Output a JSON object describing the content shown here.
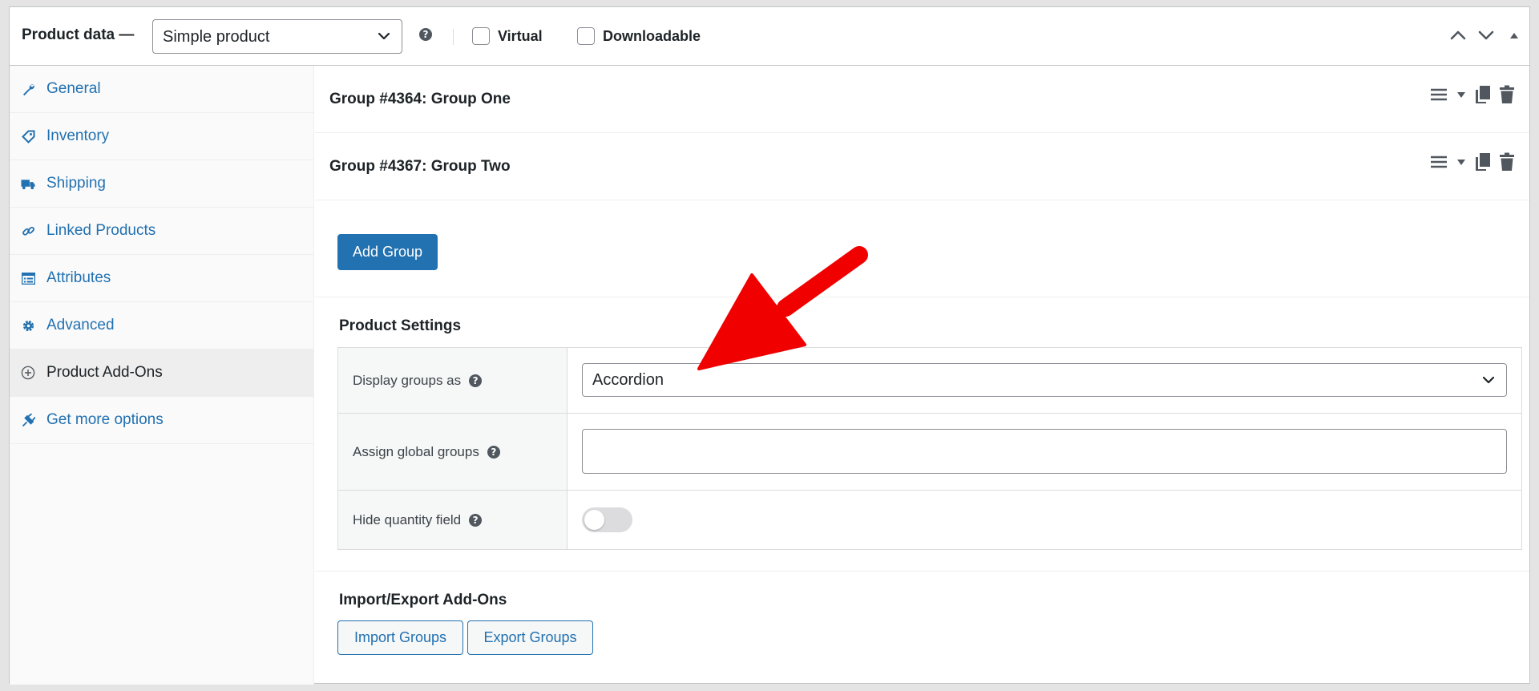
{
  "header": {
    "title": "Product data —",
    "product_type": "Simple product",
    "virtual_label": "Virtual",
    "downloadable_label": "Downloadable"
  },
  "sidebar": {
    "items": [
      {
        "label": "General",
        "icon": "wrench-icon"
      },
      {
        "label": "Inventory",
        "icon": "tag-icon"
      },
      {
        "label": "Shipping",
        "icon": "truck-icon"
      },
      {
        "label": "Linked Products",
        "icon": "link-icon"
      },
      {
        "label": "Attributes",
        "icon": "list-icon"
      },
      {
        "label": "Advanced",
        "icon": "gear-icon"
      },
      {
        "label": "Product Add-Ons",
        "icon": "plus-circle-icon"
      },
      {
        "label": "Get more options",
        "icon": "plugin-icon"
      }
    ],
    "active_index": 6
  },
  "groups": [
    {
      "title": "Group #4364: Group One"
    },
    {
      "title": "Group #4367: Group Two"
    }
  ],
  "add_group_label": "Add Group",
  "product_settings": {
    "title": "Product Settings",
    "display_groups_label": "Display groups as",
    "display_groups_value": "Accordion",
    "assign_global_label": "Assign global groups",
    "assign_global_value": "",
    "hide_quantity_label": "Hide quantity field",
    "hide_quantity_on": false
  },
  "import_export": {
    "title": "Import/Export Add-Ons",
    "import_label": "Import Groups",
    "export_label": "Export Groups"
  },
  "colors": {
    "accent": "#2271b1",
    "annotation_arrow": "#f10000"
  }
}
